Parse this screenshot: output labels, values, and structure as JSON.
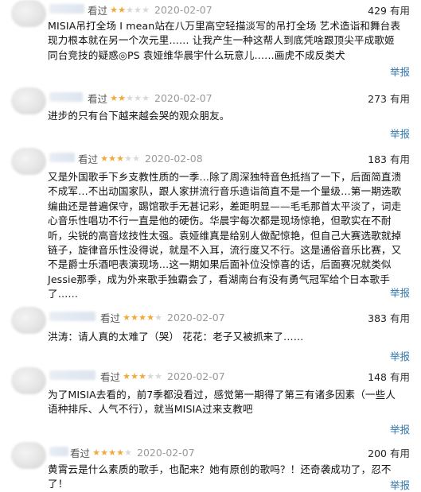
{
  "ui": {
    "watched_label": "看过",
    "report_label": "举报",
    "useful_suffix": "有用"
  },
  "comments": [
    {
      "rating": 2,
      "date": "2020-02-07",
      "useful_count": "429",
      "text": "MISIA吊打全场 I mean站在八万里高空轻描淡写的吊打全场 艺术造诣和舞台表现力根本就在另一个次元里…… 让我产生一种这帮人到底凭啥跟顶尖平成歌姬同台竞技的疑惑◎PS 袁娅维华晨宇什么玩意儿……画虎不成反类犬"
    },
    {
      "rating": 2,
      "date": "2020-02-07",
      "useful_count": "273",
      "text": "进步的只有台下越来越会哭的观众朋友。"
    },
    {
      "rating": 3,
      "date": "2020-02-08",
      "useful_count": "183",
      "text": "又是外国歌手下乡支教性质的一季…除了周深独特音色抵挡了一下，后面简直溃不成军…不出动国家队，跟人家拼流行音乐造诣简直不是一个量级…第一期选歌编曲还是普遍保守，踢馆歌手无甚记彩，差距明显——毛毛那首太平淡了，词走心音乐性唱功不行一直是他的硬伤。华晨宇每次都是现场惊艳，但歌实在不耐听，尖锐的高音炫技性太强。袁娅维真是给别人做配惊艳，但自己大赛选歌就掉链子，旋律音乐性没得说，就是不入耳，流行度又不行。这是通俗音乐比赛，又不是爵士乐酒吧表演现场…这一期如果后面补位没惊喜的话，后面赛况就类似Jessie那季，成为外来歌手独霸会了，看湖南台有没有勇气冠军给个日本歌手了……"
    },
    {
      "rating": 4,
      "date": "2020-02-07",
      "useful_count": "383",
      "text": "洪涛：请人真的太难了（哭） 花花：老子又被抓来了……"
    },
    {
      "rating": 3,
      "date": "2020-02-07",
      "useful_count": "148",
      "text": "为了MISIA去看的，前7季都没看过，感觉第一期得了第三有诸多因素（一些人语种排斥、人气不行），就当MISIA过来支教吧"
    },
    {
      "rating": 4,
      "date": "2020-02-07",
      "useful_count": "200",
      "text": "黄霄云是什么素质的歌手，也配来？她有原创的歌吗？！还奇袭成功了，忍不了！"
    }
  ]
}
